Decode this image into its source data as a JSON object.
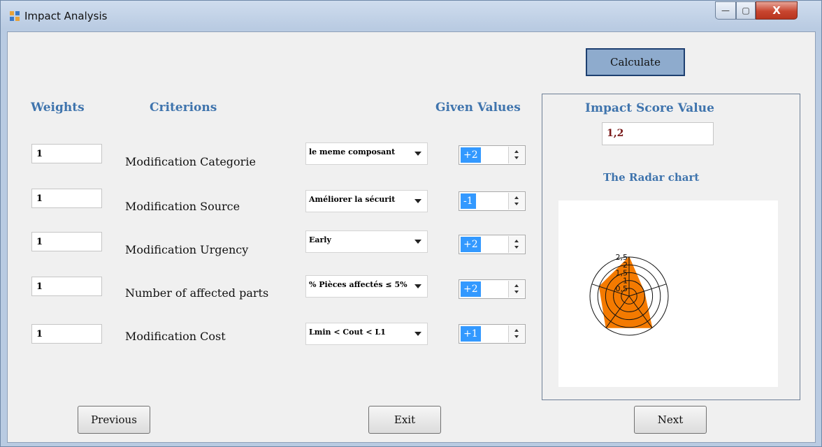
{
  "window": {
    "title": "Impact Analysis",
    "controls": {
      "minimize": "—",
      "maximize": "▢",
      "close": "X"
    }
  },
  "toolbar": {
    "calculate_label": "Calculate"
  },
  "headings": {
    "weights": "Weights",
    "criterions": "Criterions",
    "given_values": "Given Values",
    "impact_score": "Impact Score Value",
    "radar_chart": "The Radar chart"
  },
  "rows": [
    {
      "weight": "1",
      "criterion": "Modification Categorie",
      "option": "le meme composant",
      "given_value": "+2"
    },
    {
      "weight": "1",
      "criterion": "Modification Source",
      "option": "Améliorer la sécurit",
      "given_value": "-1"
    },
    {
      "weight": "1",
      "criterion": "Modification Urgency",
      "option": "Early",
      "given_value": "+2"
    },
    {
      "weight": "1",
      "criterion": "Number of affected parts",
      "option": "% Pièces affectés ≤ 5%",
      "given_value": "+2"
    },
    {
      "weight": "1",
      "criterion": "Modification Cost",
      "option": "Lmin < Cout < L1",
      "given_value": "+1"
    }
  ],
  "impact_score_value": "1,2",
  "chart_data": {
    "type": "radar",
    "axes": 5,
    "values": [
      2.5,
      1,
      2.5,
      2.5,
      2
    ],
    "rmax": 2.5,
    "ring_step": 0.5,
    "tick_labels": [
      "2,5",
      "2",
      "1,5",
      "1",
      "0,5"
    ],
    "color": "#f47a00"
  },
  "navigation": {
    "previous_label": "Previous",
    "exit_label": "Exit",
    "next_label": "Next"
  },
  "colors": {
    "heading": "#3f74ad",
    "selection": "#3399ff",
    "score_text": "#7a1a1a"
  }
}
